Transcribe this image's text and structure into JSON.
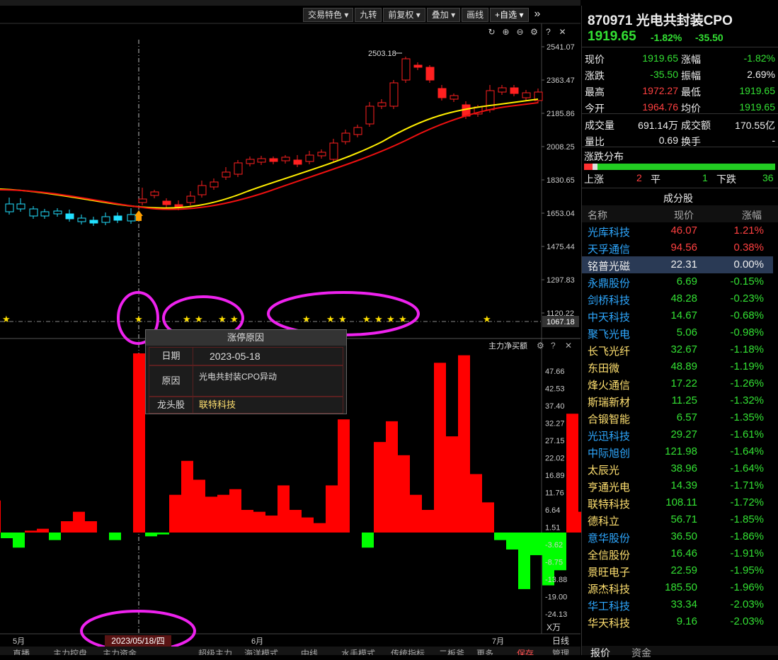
{
  "toolbar": {
    "items": [
      "交易特色",
      "九转",
      "前复权",
      "叠加",
      "画线",
      "+自选"
    ],
    "more": "»"
  },
  "chart_icons": [
    "refresh-icon",
    "zoom-in-icon",
    "zoom-out-icon",
    "gear-icon",
    "help-icon",
    "close-icon"
  ],
  "price_axis": [
    "2541.07",
    "2363.47",
    "2185.86",
    "2008.25",
    "1830.65",
    "1653.04",
    "1475.44",
    "1297.83",
    "1120.22",
    "1067.18"
  ],
  "high_marker": "2503.18",
  "indicator_title": "主力净买额",
  "indicator_axis": [
    "47.66",
    "42.53",
    "37.40",
    "32.27",
    "27.15",
    "22.02",
    "16.89",
    "11.76",
    "6.64",
    "1.51",
    "-3.62",
    "-8.75",
    "-13.88",
    "-19.00",
    "-24.13"
  ],
  "indicator_unit": "X万",
  "indicator_bars": [
    17,
    -3,
    -8,
    1,
    2,
    -4,
    6,
    11,
    6,
    0,
    -4,
    0,
    95,
    -2,
    -1,
    20,
    38,
    28,
    19,
    20,
    23,
    12,
    11,
    9,
    25,
    12,
    8,
    5,
    25,
    60,
    0,
    -8,
    48,
    59,
    41,
    20,
    12,
    90,
    51,
    94,
    31,
    16,
    -4,
    -9,
    -30,
    -12,
    -28,
    -20,
    63,
    11,
    6,
    -4,
    42
  ],
  "tooltip": {
    "title": "涨停原因",
    "rows": [
      {
        "label": "日期",
        "value": "2023-05-18"
      },
      {
        "label": "原因",
        "value": "光电共封装CPO异动"
      },
      {
        "label": "龙头股",
        "value": "联特科技"
      }
    ]
  },
  "x_axis": {
    "labels": [
      "5月",
      "6月",
      "7月"
    ],
    "highlight": "2023/05/18/四",
    "right_label": "日线"
  },
  "bottom_tabs": [
    "直播",
    "主力控盘",
    "主力资金",
    "超级主力",
    "海洋模式",
    "中线",
    "水手模式",
    "传统指标",
    "二板斧",
    "更多",
    "保存",
    "管理"
  ],
  "right_tabs": [
    "报价",
    "资金"
  ],
  "stock": {
    "code": "870971",
    "name": "光电共封装CPO",
    "price": "1919.65",
    "change_pct": "-1.82%",
    "change": "-35.50"
  },
  "quote": [
    {
      "l1": "现价",
      "v1": "1919.65",
      "c1": "green",
      "l2": "涨幅",
      "v2": "-1.82%",
      "c2": "green"
    },
    {
      "l1": "涨跌",
      "v1": "-35.50",
      "c1": "green",
      "l2": "振幅",
      "v2": "2.69%",
      "c2": "white"
    },
    {
      "l1": "最高",
      "v1": "1972.27",
      "c1": "red",
      "l2": "最低",
      "v2": "1919.65",
      "c2": "green"
    },
    {
      "l1": "今开",
      "v1": "1964.76",
      "c1": "red",
      "l2": "均价",
      "v2": "1919.65",
      "c2": "green"
    }
  ],
  "volume": [
    {
      "l1": "成交量",
      "v1": "691.14万",
      "l2": "成交额",
      "v2": "170.55亿"
    },
    {
      "l1": "量比",
      "v1": "0.69",
      "l2": "换手",
      "v2": "-"
    }
  ],
  "dist": {
    "title": "涨跌分布",
    "up_label": "上涨",
    "up": "2",
    "flat_label": "平",
    "flat": "1",
    "down_label": "下跌",
    "down": "36"
  },
  "constituents": {
    "title": "成分股",
    "headers": [
      "名称",
      "现价",
      "涨幅"
    ],
    "rows": [
      {
        "name": "光库科技",
        "price": "46.07",
        "pct": "1.21%",
        "nc": "cyan",
        "pc": "red"
      },
      {
        "name": "天孚通信",
        "price": "94.56",
        "pct": "0.38%",
        "nc": "cyan",
        "pc": "red"
      },
      {
        "name": "铭普光磁",
        "price": "22.31",
        "pct": "0.00%",
        "nc": "white",
        "pc": "white"
      },
      {
        "name": "永鼎股份",
        "price": "6.69",
        "pct": "-0.15%",
        "nc": "cyan",
        "pc": "green"
      },
      {
        "name": "剑桥科技",
        "price": "48.28",
        "pct": "-0.23%",
        "nc": "cyan",
        "pc": "green"
      },
      {
        "name": "中天科技",
        "price": "14.67",
        "pct": "-0.68%",
        "nc": "cyan",
        "pc": "green"
      },
      {
        "name": "聚飞光电",
        "price": "5.06",
        "pct": "-0.98%",
        "nc": "cyan",
        "pc": "green"
      },
      {
        "name": "长飞光纤",
        "price": "32.67",
        "pct": "-1.18%",
        "nc": "yellow",
        "pc": "green"
      },
      {
        "name": "东田微",
        "price": "48.89",
        "pct": "-1.19%",
        "nc": "yellow",
        "pc": "green"
      },
      {
        "name": "烽火通信",
        "price": "17.22",
        "pct": "-1.26%",
        "nc": "yellow",
        "pc": "green"
      },
      {
        "name": "斯瑞新材",
        "price": "11.25",
        "pct": "-1.32%",
        "nc": "yellow",
        "pc": "green"
      },
      {
        "name": "合锻智能",
        "price": "6.57",
        "pct": "-1.35%",
        "nc": "yellow",
        "pc": "green"
      },
      {
        "name": "光迅科技",
        "price": "29.27",
        "pct": "-1.61%",
        "nc": "cyan",
        "pc": "green"
      },
      {
        "name": "中际旭创",
        "price": "121.98",
        "pct": "-1.64%",
        "nc": "cyan",
        "pc": "green"
      },
      {
        "name": "太辰光",
        "price": "38.96",
        "pct": "-1.64%",
        "nc": "yellow",
        "pc": "green"
      },
      {
        "name": "亨通光电",
        "price": "14.39",
        "pct": "-1.71%",
        "nc": "yellow",
        "pc": "green"
      },
      {
        "name": "联特科技",
        "price": "108.11",
        "pct": "-1.72%",
        "nc": "yellow",
        "pc": "green"
      },
      {
        "name": "德科立",
        "price": "56.71",
        "pct": "-1.85%",
        "nc": "yellow",
        "pc": "green"
      },
      {
        "name": "意华股份",
        "price": "36.50",
        "pct": "-1.86%",
        "nc": "cyan",
        "pc": "green"
      },
      {
        "name": "全信股份",
        "price": "16.46",
        "pct": "-1.91%",
        "nc": "yellow",
        "pc": "green"
      },
      {
        "name": "景旺电子",
        "price": "22.59",
        "pct": "-1.95%",
        "nc": "yellow",
        "pc": "green"
      },
      {
        "name": "源杰科技",
        "price": "185.50",
        "pct": "-1.96%",
        "nc": "yellow",
        "pc": "green"
      },
      {
        "name": "华工科技",
        "price": "33.34",
        "pct": "-2.03%",
        "nc": "cyan",
        "pc": "green"
      },
      {
        "name": "华天科技",
        "price": "9.16",
        "pct": "-2.03%",
        "nc": "yellow",
        "pc": "green"
      }
    ]
  }
}
